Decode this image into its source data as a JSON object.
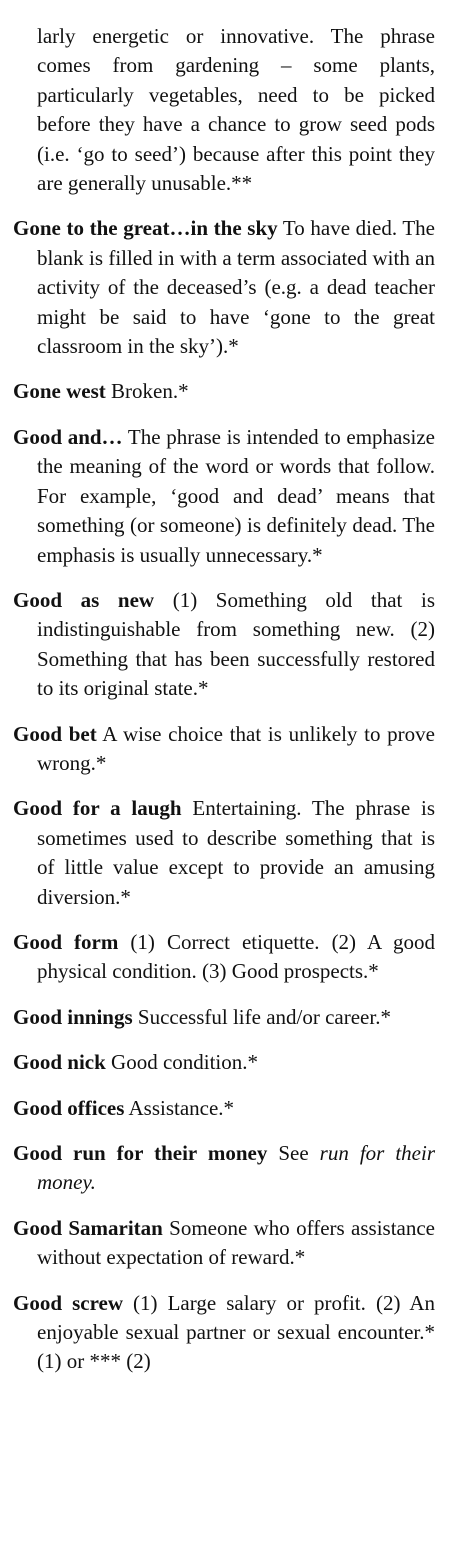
{
  "entries": [
    {
      "headword": "",
      "text": "larly energetic or innovative. The phrase comes from gardening – some plants, particularly vegetables, need to be picked before they have a chance to grow seed pods (i.e. ‘go to seed’) because after this point they are generally unusable.**"
    },
    {
      "headword": "Gone to the great…in the sky",
      "text": " To have died. The blank is filled in with a term associated with an activity of the deceased’s (e.g. a dead teacher might be said to have ‘gone to the great classroom in the sky’).*"
    },
    {
      "headword": "Gone west",
      "text": " Broken.*"
    },
    {
      "headword": "Good and…",
      "text": " The phrase is intended to emphasize the meaning of the word or words that follow. For example, ‘good and dead’ means that something (or someone) is definitely dead. The emphasis is usually unnecessary.*"
    },
    {
      "headword": "Good as new",
      "text": " (1) Something old that is indistinguishable from something new. (2) Something that has been successfully restored to its original state.*"
    },
    {
      "headword": "Good bet",
      "text": " A wise choice that is unlikely to prove wrong.*"
    },
    {
      "headword": "Good for a laugh",
      "text": " Entertaining. The phrase is sometimes used to describe something that is of little value except to provide an amusing diversion.*"
    },
    {
      "headword": "Good form",
      "text": " (1) Correct etiquette. (2) A good physical condition. (3) Good prospects.*"
    },
    {
      "headword": "Good innings",
      "text": " Successful life and/or career.*"
    },
    {
      "headword": "Good nick",
      "text": " Good condition.*"
    },
    {
      "headword": "Good offices",
      "text": " Assistance.*"
    },
    {
      "headword": "Good run for their money",
      "text": " See ",
      "xref": "run for their money."
    },
    {
      "headword": "Good Samaritan",
      "text": " Someone who offers assistance without expectation of reward.*"
    },
    {
      "headword": "Good screw",
      "text": " (1) Large salary or profit. (2) An enjoyable sexual partner or sexual encounter.* (1) or *** (2)"
    }
  ]
}
